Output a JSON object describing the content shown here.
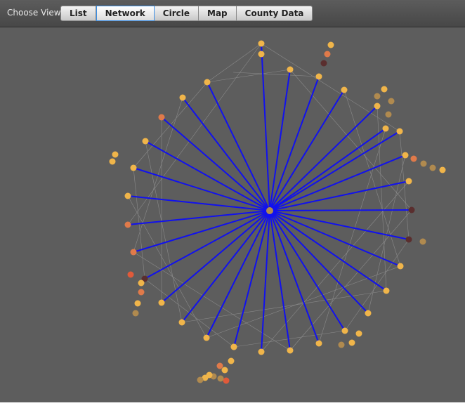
{
  "toolbar": {
    "choose_label": "Choose View",
    "tabs": [
      {
        "label": "List",
        "active": false
      },
      {
        "label": "Network",
        "active": true
      },
      {
        "label": "Circle",
        "active": false
      },
      {
        "label": "Map",
        "active": false
      },
      {
        "label": "County Data",
        "active": false
      }
    ]
  },
  "colors": {
    "background": "#5d5d5d",
    "spoke": "#1111ee",
    "faint_link": "#8a8a8a",
    "node_yellow": "#f0b54a",
    "node_tan": "#b08a4f",
    "node_orange": "#e07a4a",
    "node_red": "#e05a3a",
    "node_dark": "#5a2e2e"
  },
  "network": {
    "hub_color": "node_tan",
    "spoke_nodes": [
      {
        "color": "node_yellow"
      },
      {
        "color": "node_yellow"
      },
      {
        "color": "node_yellow"
      },
      {
        "color": "node_yellow"
      },
      {
        "color": "node_yellow"
      },
      {
        "color": "node_yellow"
      },
      {
        "color": "node_yellow"
      },
      {
        "color": "node_dark"
      },
      {
        "color": "node_dark"
      },
      {
        "color": "node_yellow"
      },
      {
        "color": "node_yellow"
      },
      {
        "color": "node_yellow"
      },
      {
        "color": "node_yellow"
      },
      {
        "color": "node_yellow"
      },
      {
        "color": "node_yellow"
      },
      {
        "color": "node_yellow"
      },
      {
        "color": "node_yellow"
      },
      {
        "color": "node_yellow"
      },
      {
        "color": "node_yellow"
      },
      {
        "color": "node_yellow"
      },
      {
        "color": "node_dark"
      },
      {
        "color": "node_orange"
      },
      {
        "color": "node_orange"
      },
      {
        "color": "node_yellow"
      },
      {
        "color": "node_yellow"
      },
      {
        "color": "node_yellow"
      },
      {
        "color": "node_orange"
      },
      {
        "color": "node_yellow"
      },
      {
        "color": "node_yellow"
      }
    ],
    "outlier_nodes": [
      {
        "color": "node_yellow"
      },
      {
        "color": "node_yellow"
      },
      {
        "color": "node_orange"
      },
      {
        "color": "node_dark"
      },
      {
        "color": "node_yellow"
      },
      {
        "color": "node_tan"
      },
      {
        "color": "node_tan"
      },
      {
        "color": "node_tan"
      },
      {
        "color": "node_orange"
      },
      {
        "color": "node_tan"
      },
      {
        "color": "node_tan"
      },
      {
        "color": "node_yellow"
      },
      {
        "color": "node_tan"
      },
      {
        "color": "node_red"
      },
      {
        "color": "node_yellow"
      },
      {
        "color": "node_orange"
      },
      {
        "color": "node_yellow"
      },
      {
        "color": "node_tan"
      },
      {
        "color": "node_yellow"
      },
      {
        "color": "node_yellow"
      },
      {
        "color": "node_tan"
      },
      {
        "color": "node_yellow"
      },
      {
        "color": "node_yellow"
      },
      {
        "color": "node_orange"
      },
      {
        "color": "node_red"
      },
      {
        "color": "node_tan"
      },
      {
        "color": "node_tan"
      },
      {
        "color": "node_yellow"
      },
      {
        "color": "node_yellow"
      },
      {
        "color": "node_yellow"
      },
      {
        "color": "node_tan"
      },
      {
        "color": "node_yellow"
      },
      {
        "color": "node_yellow"
      }
    ]
  }
}
